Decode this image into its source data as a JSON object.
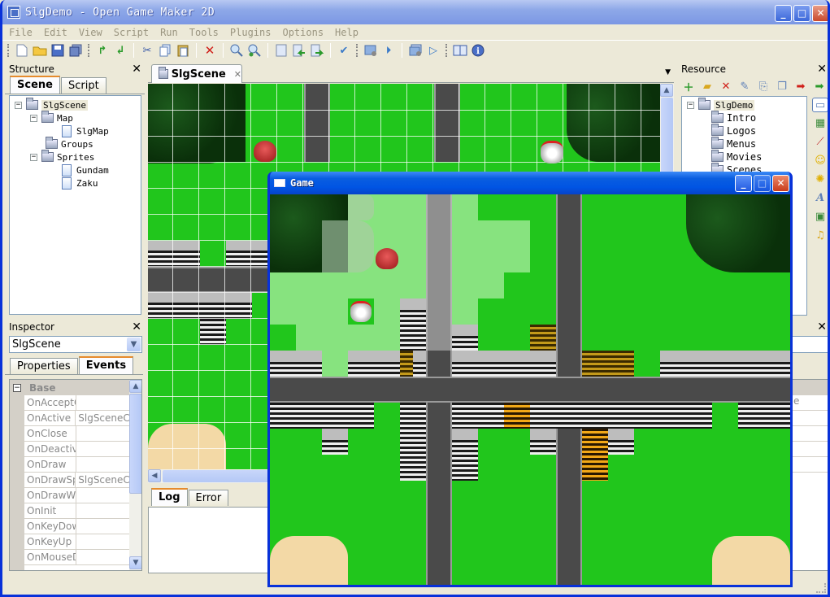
{
  "window": {
    "title": "SlgDemo - Open Game Maker 2D",
    "minimize": "_",
    "maximize": "□",
    "close": "✕"
  },
  "menu": [
    "File",
    "Edit",
    "View",
    "Script",
    "Run",
    "Tools",
    "Plugins",
    "Options",
    "Help"
  ],
  "toolbar": {
    "icons": [
      "new-icon",
      "open-icon",
      "save-icon",
      "save-all-icon",
      "redo-icon",
      "undo-icon",
      "cut-icon",
      "copy-icon",
      "paste-icon",
      "delete-icon",
      "zoom-in-icon",
      "zoom-out-icon",
      "bookmark-icon",
      "prev-bookmark-icon",
      "next-bookmark-icon",
      "spell-check-icon",
      "build-icon",
      "run-step-icon",
      "build-all-icon",
      "run-icon",
      "help-book-icon",
      "about-icon"
    ]
  },
  "structure": {
    "title": "Structure",
    "tabs": [
      "Scene",
      "Script"
    ],
    "active_tab": "Scene",
    "tree": [
      {
        "label": "SlgScene",
        "type": "folder",
        "level": 0,
        "expanded": true
      },
      {
        "label": "Map",
        "type": "folder",
        "level": 1,
        "expanded": true
      },
      {
        "label": "SlgMap",
        "type": "doc",
        "level": 2
      },
      {
        "label": "Groups",
        "type": "folder",
        "level": 1
      },
      {
        "label": "Sprites",
        "type": "folder",
        "level": 1,
        "expanded": true
      },
      {
        "label": "Gundam",
        "type": "doc",
        "level": 2
      },
      {
        "label": "Zaku",
        "type": "doc",
        "level": 2
      }
    ]
  },
  "inspector": {
    "title": "Inspector",
    "selected": "SlgScene",
    "tabs": [
      "Properties",
      "Events"
    ],
    "active_tab": "Events",
    "category": "Base",
    "rows": [
      {
        "name": "OnAcceptC",
        "value": ""
      },
      {
        "name": "OnActive",
        "value": "SlgSceneC"
      },
      {
        "name": "OnClose",
        "value": ""
      },
      {
        "name": "OnDeactive",
        "value": ""
      },
      {
        "name": "OnDraw",
        "value": ""
      },
      {
        "name": "OnDrawSp",
        "value": "SlgSceneC"
      },
      {
        "name": "OnDrawWi",
        "value": ""
      },
      {
        "name": "OnInit",
        "value": ""
      },
      {
        "name": "OnKeyDow",
        "value": ""
      },
      {
        "name": "OnKeyUp",
        "value": ""
      },
      {
        "name": "OnMouseD",
        "value": ""
      }
    ]
  },
  "editor": {
    "tab_label": "SlgScene",
    "tab_close": "✕",
    "dropdown": "▼"
  },
  "log": {
    "tabs": [
      "Log",
      "Error"
    ],
    "active_tab": "Log"
  },
  "resource": {
    "title": "Resource",
    "toolbar_icons": [
      "add-resource-icon",
      "add-folder-icon",
      "remove-resource-icon",
      "edit-resource-icon",
      "import-icon",
      "copy-resource-icon",
      "export-red-icon",
      "export-green-icon"
    ],
    "tree": [
      {
        "label": "SlgDemo",
        "type": "folder",
        "level": 0,
        "expanded": true
      },
      {
        "label": "Intro",
        "type": "folder",
        "level": 1
      },
      {
        "label": "Logos",
        "type": "folder",
        "level": 1
      },
      {
        "label": "Menus",
        "type": "folder",
        "level": 1
      },
      {
        "label": "Movies",
        "type": "folder",
        "level": 1
      },
      {
        "label": "Scenes",
        "type": "folder",
        "level": 1
      }
    ],
    "side_icons": [
      "window-resource-icon",
      "image-resource-icon",
      "path-resource-icon",
      "sprite-resource-icon",
      "particle-resource-icon",
      "font-resource-icon",
      "tileset-resource-icon",
      "music-resource-icon"
    ]
  },
  "right_inspector": {
    "close": "✕",
    "partial_value": "e"
  },
  "game": {
    "title": "Game",
    "minimize": "_",
    "maximize": "□",
    "close": "✕"
  }
}
